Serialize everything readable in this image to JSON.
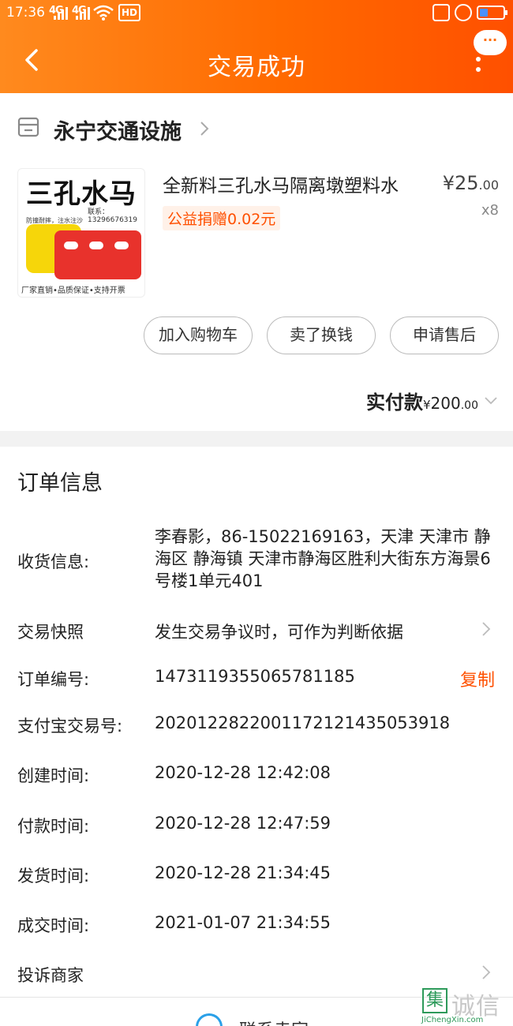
{
  "status_bar": {
    "time": "17:36",
    "signal1": "4G",
    "signal2": "4G",
    "hd": "HD",
    "icon_names": [
      "signal-icon",
      "wifi-icon",
      "hd-icon",
      "vibrate-icon",
      "alarm-icon",
      "battery-icon"
    ]
  },
  "header": {
    "title": "交易成功",
    "bubble_text": "···"
  },
  "shop": {
    "name": "永宁交通设施"
  },
  "product": {
    "title": "全新料三孔水马隔离墩塑料水",
    "price_symbol": "¥",
    "price_int": "25",
    "price_dec": ".00",
    "quantity": "x8",
    "charity": "公益捐赠0.02元",
    "image": {
      "headline": "三孔水马",
      "contact": "联系：13296676319",
      "tagline": "防撞耐摔，注水注沙",
      "footer": "厂家直销•品质保证•支持开票"
    }
  },
  "actions": {
    "add_to_cart": "加入购物车",
    "resell": "卖了换钱",
    "after_sales": "申请售后"
  },
  "payment": {
    "label": "实付款",
    "symbol": "¥",
    "amount_int": "200",
    "amount_dec": ".00"
  },
  "order_info": {
    "section_title": "订单信息",
    "shipping_label": "收货信息:",
    "shipping_value": "李春影，86-15022169163，天津 天津市 静海区 静海镇 天津市静海区胜利大街东方海景6号楼1单元401",
    "snapshot_label": "交易快照",
    "snapshot_value": "发生交易争议时，可作为判断依据",
    "order_no_label": "订单编号:",
    "order_no_value": "1473119355065781185",
    "copy_label": "复制",
    "alipay_label": "支付宝交易号:",
    "alipay_value": "2020122822001172121435053918",
    "created_label": "创建时间:",
    "created_value": "2020-12-28 12:42:08",
    "paid_label": "付款时间:",
    "paid_value": "2020-12-28 12:47:59",
    "shipped_label": "发货时间:",
    "shipped_value": "2020-12-28 21:34:45",
    "deal_label": "成交时间:",
    "deal_value": "2021-01-07 21:34:55",
    "complaint_label": "投诉商家"
  },
  "footer": {
    "contact_seller": "联系卖家"
  },
  "watermark": {
    "box_char": "集",
    "text_cn": "诚信",
    "text_en": "JiChengXin.com"
  },
  "colors": {
    "header_start": "#ff8a1e",
    "header_end": "#ff5000",
    "accent": "#ff5000",
    "battery_fill": "#4a90ff",
    "contact_icon": "#2aa0e8",
    "watermark_green": "#2d9a5a"
  }
}
